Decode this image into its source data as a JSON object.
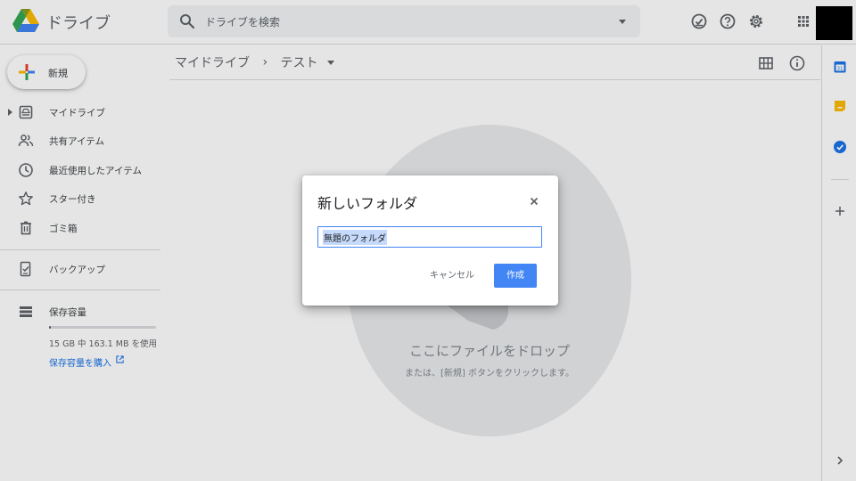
{
  "app": {
    "title": "ドライブ"
  },
  "search": {
    "placeholder": "ドライブを検索"
  },
  "sidebar": {
    "new_label": "新規",
    "items": [
      {
        "label": "マイドライブ"
      },
      {
        "label": "共有アイテム"
      },
      {
        "label": "最近使用したアイテム"
      },
      {
        "label": "スター付き"
      },
      {
        "label": "ゴミ箱"
      },
      {
        "label": "バックアップ"
      },
      {
        "label": "保存容量"
      }
    ],
    "storage": {
      "used_text": "15 GB 中 163.1 MB を使用",
      "used_fraction": 0.011,
      "buy_label": "保存容量を購入"
    }
  },
  "breadcrumb": {
    "root": "マイドライブ",
    "separator": "›",
    "current": "テスト"
  },
  "empty_state": {
    "title": "ここにファイルをドロップ",
    "subtitle": "または、[新規] ボタンをクリックします。"
  },
  "dialog": {
    "title": "新しいフォルダ",
    "close_symbol": "×",
    "input_value": "無題のフォルダ",
    "cancel_label": "キャンセル",
    "create_label": "作成"
  },
  "colors": {
    "accent": "#4285f4",
    "link": "#1a73e8",
    "selection": "#c6dafc"
  }
}
